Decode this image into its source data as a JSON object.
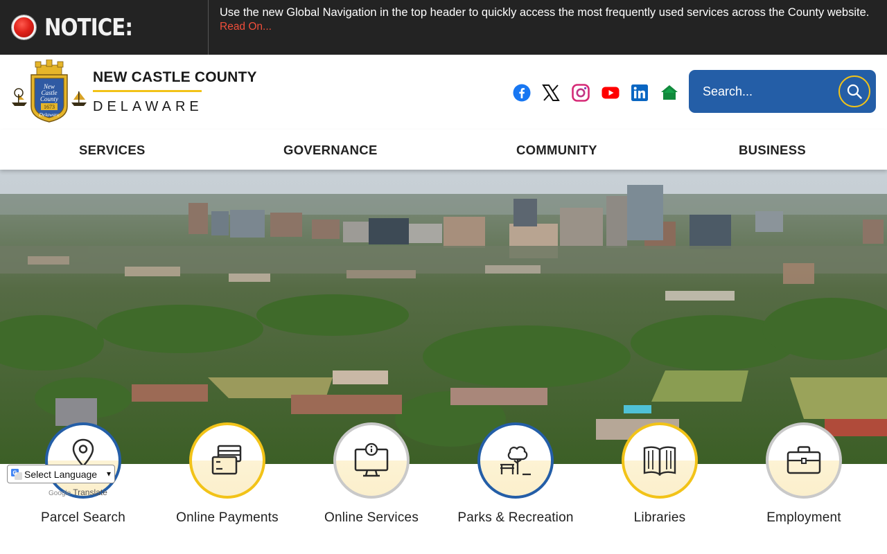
{
  "notice": {
    "title": "NOTICE:",
    "message": "Use the new Global Navigation in the top header to quickly access the most frequently used services across the County website.",
    "link_label": "Read On..."
  },
  "brand": {
    "name": "NEW CASTLE COUNTY",
    "subtitle": "DELAWARE",
    "seal_lines": [
      "New",
      "Castle",
      "County",
      "1673",
      "Delaware"
    ]
  },
  "social": [
    {
      "name": "facebook-icon",
      "color": "#1877f2"
    },
    {
      "name": "x-icon",
      "color": "#111111"
    },
    {
      "name": "instagram-icon",
      "color": "#d62976"
    },
    {
      "name": "youtube-icon",
      "color": "#ff0000"
    },
    {
      "name": "linkedin-icon",
      "color": "#0a66c2"
    },
    {
      "name": "home-icon",
      "color": "#118a3c"
    }
  ],
  "search": {
    "placeholder": "Search..."
  },
  "nav": [
    "SERVICES",
    "GOVERNANCE",
    "COMMUNITY",
    "BUSINESS"
  ],
  "quick_links": [
    {
      "label": "Parcel Search",
      "icon": "map-pin-icon",
      "ring": "blue"
    },
    {
      "label": "Online Payments",
      "icon": "credit-card-icon",
      "ring": "gold"
    },
    {
      "label": "Online Services",
      "icon": "monitor-info-icon",
      "ring": "grey"
    },
    {
      "label": "Parks & Recreation",
      "icon": "park-bench-tree-icon",
      "ring": "blue"
    },
    {
      "label": "Libraries",
      "icon": "open-book-icon",
      "ring": "gold"
    },
    {
      "label": "Employment",
      "icon": "briefcase-icon",
      "ring": "grey"
    }
  ],
  "translate": {
    "select_label": "Select Language",
    "powered_brand": "Google",
    "powered_text": "Translate"
  },
  "colors": {
    "brand_blue": "#245ea7",
    "brand_gold": "#f2c318",
    "notice_bg": "#232323",
    "notice_link": "#f04e3a"
  }
}
